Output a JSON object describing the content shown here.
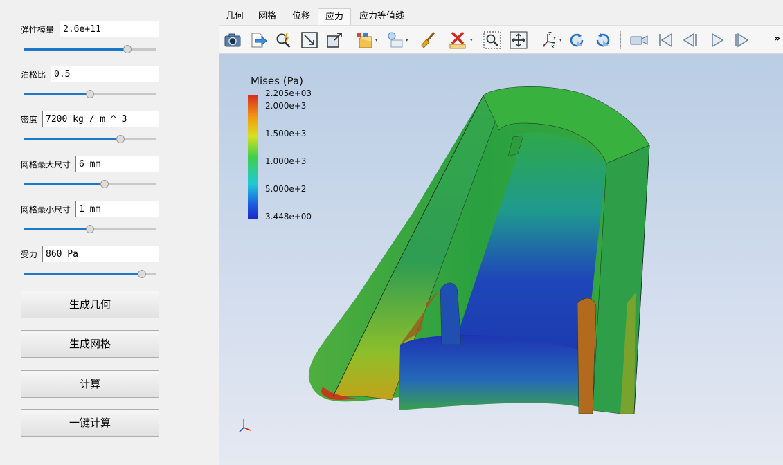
{
  "params": [
    {
      "label": "弹性模量",
      "value": "2.6e+11",
      "slider": 0.78
    },
    {
      "label": "泊松比",
      "value": "0.5",
      "slider": 0.5
    },
    {
      "label": "密度",
      "value": "7200 kg / m ^ 3",
      "slider": 0.73
    },
    {
      "label": "网格最大尺寸",
      "value": "6 mm",
      "slider": 0.61
    },
    {
      "label": "网格最小尺寸",
      "value": "1 mm",
      "slider": 0.5
    },
    {
      "label": "受力",
      "value": "860 Pa",
      "slider": 0.89
    }
  ],
  "buttons": {
    "gen_geometry": "生成几何",
    "gen_mesh": "生成网格",
    "compute": "计算",
    "one_click": "一键计算"
  },
  "tabs": [
    "几何",
    "网格",
    "位移",
    "应力",
    "应力等值线"
  ],
  "active_tab": "应力",
  "toolbar_icons": [
    "camera-icon",
    "export-icon",
    "pick-icon",
    "reset-camera-icon",
    "zoom-fit-icon",
    "representation-icon",
    "light-icon",
    "clear-icon",
    "delete-icon",
    "zoom-to-box-icon",
    "zoom-data-icon",
    "axes-icon",
    "rotate-cw-icon",
    "rotate-ccw-icon",
    "camera-record-icon",
    "first-frame-icon",
    "prev-frame-icon",
    "play-icon",
    "last-frame-icon"
  ],
  "more": "»",
  "legend": {
    "title": "Mises (Pa)",
    "ticks": [
      "2.205e+03",
      "2.000e+3",
      "1.500e+3",
      "1.000e+3",
      "5.000e+2",
      "3.448e+00"
    ]
  },
  "colors": {
    "accent": "#1c77c9",
    "max": "#e0301e",
    "min": "#1a28c8"
  }
}
